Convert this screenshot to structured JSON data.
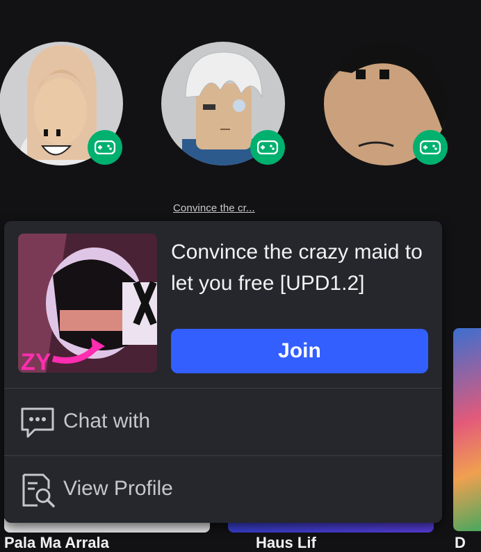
{
  "friends": [
    {
      "avatar_icon": "blonde-avatar",
      "presence_icon": "gamepad-icon"
    },
    {
      "avatar_icon": "white-hair-avatar",
      "presence_icon": "gamepad-icon"
    },
    {
      "avatar_icon": "black-hair-avatar",
      "presence_icon": "gamepad-icon"
    }
  ],
  "selected_friend_game_short": "Convince the cr...",
  "popup": {
    "game_title": "Convince the crazy maid to let you free [UPD1.2]",
    "thumbnail_text": "ZY",
    "join_label": "Join",
    "chat_label": "Chat with",
    "profile_label": "View Profile"
  },
  "background_games": [
    {
      "partial_title": "Pala Ma Arrala"
    },
    {
      "partial_title": "Haus Lif"
    },
    {
      "partial_title": "D"
    }
  ],
  "colors": {
    "accent": "#335fff",
    "presence": "#00b06f",
    "popup_bg": "#25272d",
    "page_bg": "#121215"
  }
}
